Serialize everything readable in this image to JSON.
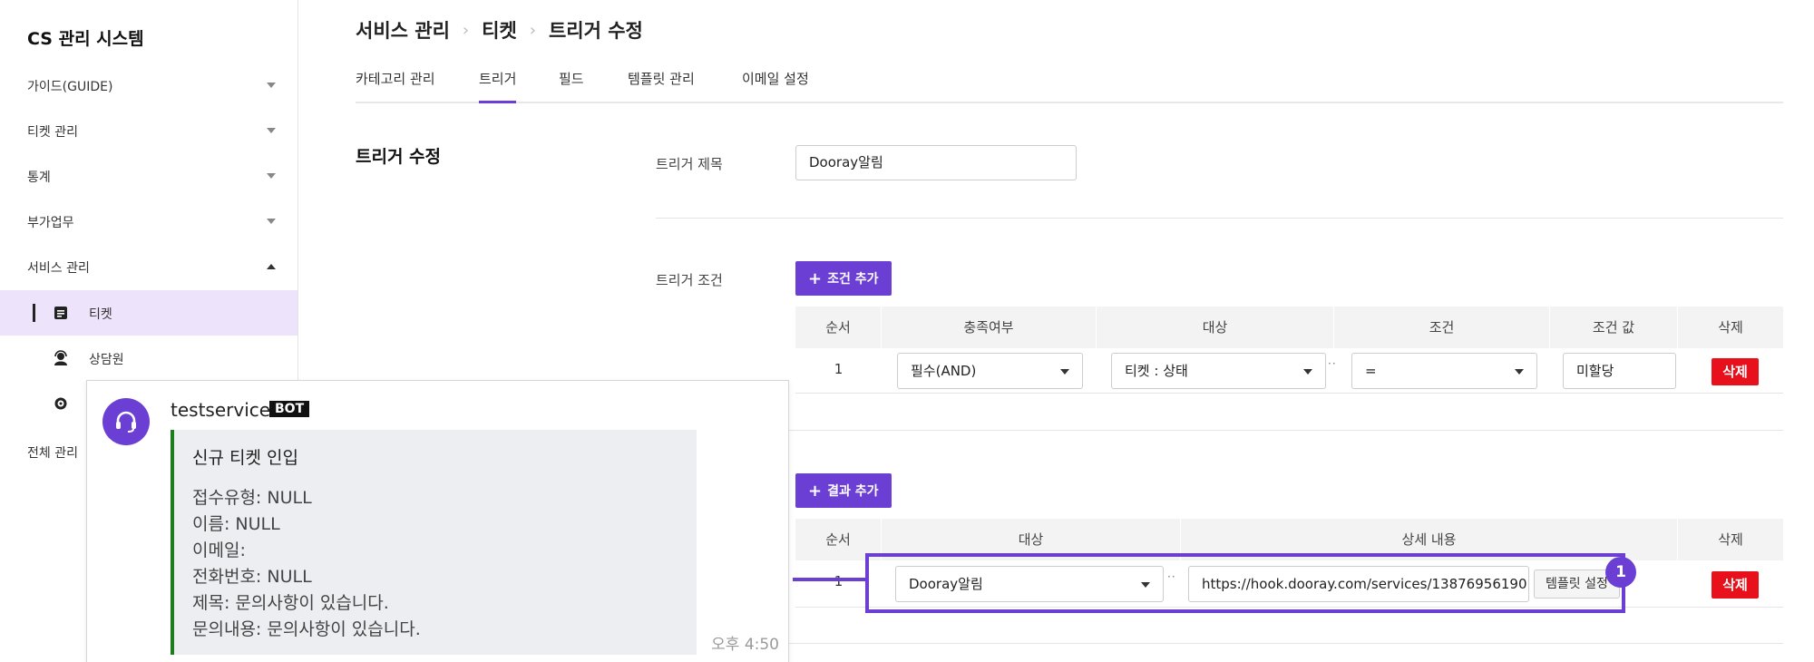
{
  "sidebar": {
    "app_title": "CS 관리 시스템",
    "menu": [
      {
        "label": "가이드(GUIDE)"
      },
      {
        "label": "티켓 관리"
      },
      {
        "label": "통계"
      },
      {
        "label": "부가업무"
      },
      {
        "label": "서비스 관리"
      }
    ],
    "sub_items": [
      {
        "label": "티켓",
        "icon": "document-icon"
      },
      {
        "label": "상담원",
        "icon": "agent-icon"
      },
      {
        "label": "",
        "icon": "settings-icon"
      }
    ],
    "bottom_label": "전체 관리"
  },
  "breadcrumb": [
    "서비스 관리",
    "티켓",
    "트리거 수정"
  ],
  "tabs": [
    "카테고리 관리",
    "트리거",
    "필드",
    "템플릿 관리",
    "이메일 설정"
  ],
  "active_tab": "트리거",
  "form": {
    "section_title": "트리거 수정",
    "trigger_title_label": "트리거 제목",
    "trigger_title_value": "Dooray알림",
    "trigger_condition_label": "트리거 조건",
    "add_condition_label": "조건 추가",
    "add_result_label": "결과 추가"
  },
  "condition_table": {
    "headers": [
      "순서",
      "충족여부",
      "대상",
      "조건",
      "조건 값",
      "삭제"
    ],
    "rows": [
      {
        "order": "1",
        "requirement": "필수(AND)",
        "target": "티켓 : 상태",
        "operator": "=",
        "value": "미할당",
        "delete": "삭제"
      }
    ]
  },
  "result_table": {
    "headers": [
      "순서",
      "대상",
      "상세 내용",
      "삭제"
    ],
    "rows": [
      {
        "order": "1",
        "target": "Dooray알림",
        "detail": "https://hook.dooray.com/services/13876956190",
        "template_button": "템플릿 설정",
        "delete": "삭제"
      }
    ]
  },
  "callout_badge": "1",
  "chat_preview": {
    "sender": "testservice",
    "bot_tag": "BOT",
    "card_title": "신규 티켓 인입",
    "lines": [
      "접수유형: NULL",
      "이름: NULL",
      "이메일:",
      "전화번호: NULL",
      "제목: 문의사항이 있습니다.",
      "문의내용: 문의사항이 있습니다."
    ],
    "time": "오후 4:50"
  },
  "colors": {
    "accent": "#6c3fd4",
    "delete": "#e8101a",
    "active_bg": "#ede3fb",
    "card_border": "#1e7b1e"
  }
}
